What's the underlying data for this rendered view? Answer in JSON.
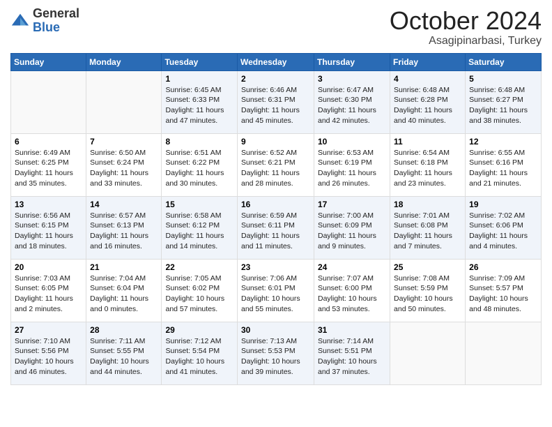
{
  "header": {
    "logo_general": "General",
    "logo_blue": "Blue",
    "title": "October 2024",
    "location": "Asagipinarbasi, Turkey"
  },
  "weekdays": [
    "Sunday",
    "Monday",
    "Tuesday",
    "Wednesday",
    "Thursday",
    "Friday",
    "Saturday"
  ],
  "weeks": [
    [
      {
        "day": "",
        "sunrise": "",
        "sunset": "",
        "daylight": ""
      },
      {
        "day": "",
        "sunrise": "",
        "sunset": "",
        "daylight": ""
      },
      {
        "day": "1",
        "sunrise": "Sunrise: 6:45 AM",
        "sunset": "Sunset: 6:33 PM",
        "daylight": "Daylight: 11 hours and 47 minutes."
      },
      {
        "day": "2",
        "sunrise": "Sunrise: 6:46 AM",
        "sunset": "Sunset: 6:31 PM",
        "daylight": "Daylight: 11 hours and 45 minutes."
      },
      {
        "day": "3",
        "sunrise": "Sunrise: 6:47 AM",
        "sunset": "Sunset: 6:30 PM",
        "daylight": "Daylight: 11 hours and 42 minutes."
      },
      {
        "day": "4",
        "sunrise": "Sunrise: 6:48 AM",
        "sunset": "Sunset: 6:28 PM",
        "daylight": "Daylight: 11 hours and 40 minutes."
      },
      {
        "day": "5",
        "sunrise": "Sunrise: 6:48 AM",
        "sunset": "Sunset: 6:27 PM",
        "daylight": "Daylight: 11 hours and 38 minutes."
      }
    ],
    [
      {
        "day": "6",
        "sunrise": "Sunrise: 6:49 AM",
        "sunset": "Sunset: 6:25 PM",
        "daylight": "Daylight: 11 hours and 35 minutes."
      },
      {
        "day": "7",
        "sunrise": "Sunrise: 6:50 AM",
        "sunset": "Sunset: 6:24 PM",
        "daylight": "Daylight: 11 hours and 33 minutes."
      },
      {
        "day": "8",
        "sunrise": "Sunrise: 6:51 AM",
        "sunset": "Sunset: 6:22 PM",
        "daylight": "Daylight: 11 hours and 30 minutes."
      },
      {
        "day": "9",
        "sunrise": "Sunrise: 6:52 AM",
        "sunset": "Sunset: 6:21 PM",
        "daylight": "Daylight: 11 hours and 28 minutes."
      },
      {
        "day": "10",
        "sunrise": "Sunrise: 6:53 AM",
        "sunset": "Sunset: 6:19 PM",
        "daylight": "Daylight: 11 hours and 26 minutes."
      },
      {
        "day": "11",
        "sunrise": "Sunrise: 6:54 AM",
        "sunset": "Sunset: 6:18 PM",
        "daylight": "Daylight: 11 hours and 23 minutes."
      },
      {
        "day": "12",
        "sunrise": "Sunrise: 6:55 AM",
        "sunset": "Sunset: 6:16 PM",
        "daylight": "Daylight: 11 hours and 21 minutes."
      }
    ],
    [
      {
        "day": "13",
        "sunrise": "Sunrise: 6:56 AM",
        "sunset": "Sunset: 6:15 PM",
        "daylight": "Daylight: 11 hours and 18 minutes."
      },
      {
        "day": "14",
        "sunrise": "Sunrise: 6:57 AM",
        "sunset": "Sunset: 6:13 PM",
        "daylight": "Daylight: 11 hours and 16 minutes."
      },
      {
        "day": "15",
        "sunrise": "Sunrise: 6:58 AM",
        "sunset": "Sunset: 6:12 PM",
        "daylight": "Daylight: 11 hours and 14 minutes."
      },
      {
        "day": "16",
        "sunrise": "Sunrise: 6:59 AM",
        "sunset": "Sunset: 6:11 PM",
        "daylight": "Daylight: 11 hours and 11 minutes."
      },
      {
        "day": "17",
        "sunrise": "Sunrise: 7:00 AM",
        "sunset": "Sunset: 6:09 PM",
        "daylight": "Daylight: 11 hours and 9 minutes."
      },
      {
        "day": "18",
        "sunrise": "Sunrise: 7:01 AM",
        "sunset": "Sunset: 6:08 PM",
        "daylight": "Daylight: 11 hours and 7 minutes."
      },
      {
        "day": "19",
        "sunrise": "Sunrise: 7:02 AM",
        "sunset": "Sunset: 6:06 PM",
        "daylight": "Daylight: 11 hours and 4 minutes."
      }
    ],
    [
      {
        "day": "20",
        "sunrise": "Sunrise: 7:03 AM",
        "sunset": "Sunset: 6:05 PM",
        "daylight": "Daylight: 11 hours and 2 minutes."
      },
      {
        "day": "21",
        "sunrise": "Sunrise: 7:04 AM",
        "sunset": "Sunset: 6:04 PM",
        "daylight": "Daylight: 11 hours and 0 minutes."
      },
      {
        "day": "22",
        "sunrise": "Sunrise: 7:05 AM",
        "sunset": "Sunset: 6:02 PM",
        "daylight": "Daylight: 10 hours and 57 minutes."
      },
      {
        "day": "23",
        "sunrise": "Sunrise: 7:06 AM",
        "sunset": "Sunset: 6:01 PM",
        "daylight": "Daylight: 10 hours and 55 minutes."
      },
      {
        "day": "24",
        "sunrise": "Sunrise: 7:07 AM",
        "sunset": "Sunset: 6:00 PM",
        "daylight": "Daylight: 10 hours and 53 minutes."
      },
      {
        "day": "25",
        "sunrise": "Sunrise: 7:08 AM",
        "sunset": "Sunset: 5:59 PM",
        "daylight": "Daylight: 10 hours and 50 minutes."
      },
      {
        "day": "26",
        "sunrise": "Sunrise: 7:09 AM",
        "sunset": "Sunset: 5:57 PM",
        "daylight": "Daylight: 10 hours and 48 minutes."
      }
    ],
    [
      {
        "day": "27",
        "sunrise": "Sunrise: 7:10 AM",
        "sunset": "Sunset: 5:56 PM",
        "daylight": "Daylight: 10 hours and 46 minutes."
      },
      {
        "day": "28",
        "sunrise": "Sunrise: 7:11 AM",
        "sunset": "Sunset: 5:55 PM",
        "daylight": "Daylight: 10 hours and 44 minutes."
      },
      {
        "day": "29",
        "sunrise": "Sunrise: 7:12 AM",
        "sunset": "Sunset: 5:54 PM",
        "daylight": "Daylight: 10 hours and 41 minutes."
      },
      {
        "day": "30",
        "sunrise": "Sunrise: 7:13 AM",
        "sunset": "Sunset: 5:53 PM",
        "daylight": "Daylight: 10 hours and 39 minutes."
      },
      {
        "day": "31",
        "sunrise": "Sunrise: 7:14 AM",
        "sunset": "Sunset: 5:51 PM",
        "daylight": "Daylight: 10 hours and 37 minutes."
      },
      {
        "day": "",
        "sunrise": "",
        "sunset": "",
        "daylight": ""
      },
      {
        "day": "",
        "sunrise": "",
        "sunset": "",
        "daylight": ""
      }
    ]
  ]
}
